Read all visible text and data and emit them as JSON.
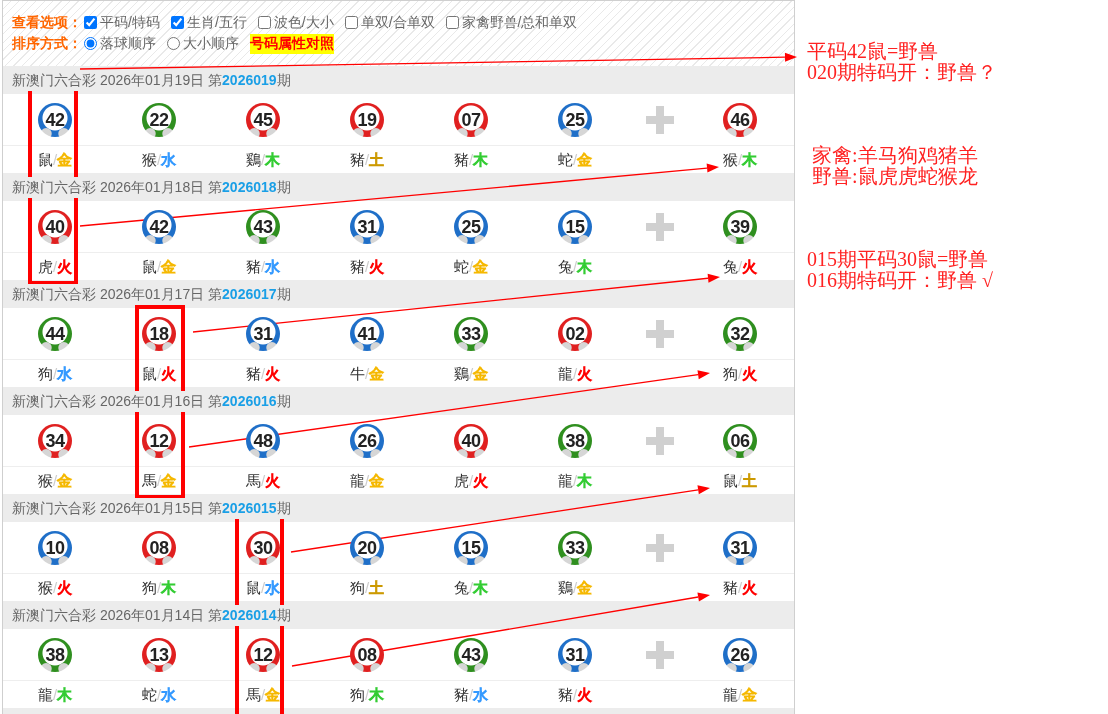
{
  "options": {
    "label": "查看选项：",
    "items": [
      {
        "label": "平码/特码",
        "checked": true
      },
      {
        "label": "生肖/五行",
        "checked": true
      },
      {
        "label": "波色/大小",
        "checked": false
      },
      {
        "label": "单双/合单双",
        "checked": false
      },
      {
        "label": "家禽野兽/总和单双",
        "checked": false
      }
    ]
  },
  "sorting": {
    "label": "排序方式：",
    "items": [
      {
        "label": "落球顺序",
        "selected": true
      },
      {
        "label": "大小顺序",
        "selected": false
      }
    ],
    "link": "号码属性对照"
  },
  "draws": [
    {
      "title": "新澳门六合彩 2026年01月19日 第**2026019**期",
      "numbers": [
        {
          "number": "42",
          "color": "#1f6fc8",
          "zodiac": "鼠",
          "separator": "/",
          "element": {
            "text": "金",
            "color": "#f5b800"
          }
        },
        {
          "number": "22",
          "color": "#2f8f1f",
          "zodiac": "猴",
          "separator": "/",
          "element": {
            "text": "水",
            "color": "#3399ff"
          }
        },
        {
          "number": "45",
          "color": "#e02020",
          "zodiac": "鷄",
          "separator": "/",
          "element": {
            "text": "木",
            "color": "#33cc33"
          }
        },
        {
          "number": "19",
          "color": "#e02020",
          "zodiac": "豬",
          "separator": "/",
          "element": {
            "text": "土",
            "color": "#cc9900"
          }
        },
        {
          "number": "07",
          "color": "#e02020",
          "zodiac": "豬",
          "separator": "/",
          "element": {
            "text": "木",
            "color": "#33cc33"
          }
        },
        {
          "number": "25",
          "color": "#1f6fc8",
          "zodiac": "蛇",
          "separator": "/",
          "element": {
            "text": "金",
            "color": "#f5b800"
          }
        }
      ],
      "special": {
        "number": "46",
        "color": "#e02020",
        "zodiac": "猴",
        "separator": "/",
        "element": {
          "text": "木",
          "color": "#33cc33"
        }
      }
    },
    {
      "title": "新澳门六合彩 2026年01月18日 第**2026018**期",
      "numbers": [
        {
          "number": "40",
          "color": "#e02020",
          "zodiac": "虎",
          "separator": "/",
          "element": {
            "text": "火",
            "color": "#ff0000"
          }
        },
        {
          "number": "42",
          "color": "#1f6fc8",
          "zodiac": "鼠",
          "separator": "/",
          "element": {
            "text": "金",
            "color": "#f5b800"
          }
        },
        {
          "number": "43",
          "color": "#2f8f1f",
          "zodiac": "豬",
          "separator": "/",
          "element": {
            "text": "水",
            "color": "#3399ff"
          }
        },
        {
          "number": "31",
          "color": "#1f6fc8",
          "zodiac": "豬",
          "separator": "/",
          "element": {
            "text": "火",
            "color": "#ff0000"
          }
        },
        {
          "number": "25",
          "color": "#1f6fc8",
          "zodiac": "蛇",
          "separator": "/",
          "element": {
            "text": "金",
            "color": "#f5b800"
          }
        },
        {
          "number": "15",
          "color": "#1f6fc8",
          "zodiac": "兔",
          "separator": "/",
          "element": {
            "text": "木",
            "color": "#33cc33"
          }
        }
      ],
      "special": {
        "number": "39",
        "color": "#2f8f1f",
        "zodiac": "兔",
        "separator": "/",
        "element": {
          "text": "火",
          "color": "#ff0000"
        }
      }
    },
    {
      "title": "新澳门六合彩 2026年01月17日 第**2026017**期",
      "numbers": [
        {
          "number": "44",
          "color": "#2f8f1f",
          "zodiac": "狗",
          "separator": "/",
          "element": {
            "text": "水",
            "color": "#3399ff"
          }
        },
        {
          "number": "18",
          "color": "#e02020",
          "zodiac": "鼠",
          "separator": "/",
          "element": {
            "text": "火",
            "color": "#ff0000"
          }
        },
        {
          "number": "31",
          "color": "#1f6fc8",
          "zodiac": "豬",
          "separator": "/",
          "element": {
            "text": "火",
            "color": "#ff0000"
          }
        },
        {
          "number": "41",
          "color": "#1f6fc8",
          "zodiac": "牛",
          "separator": "/",
          "element": {
            "text": "金",
            "color": "#f5b800"
          }
        },
        {
          "number": "33",
          "color": "#2f8f1f",
          "zodiac": "鷄",
          "separator": "/",
          "element": {
            "text": "金",
            "color": "#f5b800"
          }
        },
        {
          "number": "02",
          "color": "#e02020",
          "zodiac": "龍",
          "separator": "/",
          "element": {
            "text": "火",
            "color": "#ff0000"
          }
        }
      ],
      "special": {
        "number": "32",
        "color": "#2f8f1f",
        "zodiac": "狗",
        "separator": "/",
        "element": {
          "text": "火",
          "color": "#ff0000"
        }
      }
    },
    {
      "title": "新澳门六合彩 2026年01月16日 第**2026016**期",
      "numbers": [
        {
          "number": "34",
          "color": "#e02020",
          "zodiac": "猴",
          "separator": "/",
          "element": {
            "text": "金",
            "color": "#f5b800"
          }
        },
        {
          "number": "12",
          "color": "#e02020",
          "zodiac": "馬",
          "separator": "/",
          "element": {
            "text": "金",
            "color": "#f5b800"
          }
        },
        {
          "number": "48",
          "color": "#1f6fc8",
          "zodiac": "馬",
          "separator": "/",
          "element": {
            "text": "火",
            "color": "#ff0000"
          }
        },
        {
          "number": "26",
          "color": "#1f6fc8",
          "zodiac": "龍",
          "separator": "/",
          "element": {
            "text": "金",
            "color": "#f5b800"
          }
        },
        {
          "number": "40",
          "color": "#e02020",
          "zodiac": "虎",
          "separator": "/",
          "element": {
            "text": "火",
            "color": "#ff0000"
          }
        },
        {
          "number": "38",
          "color": "#2f8f1f",
          "zodiac": "龍",
          "separator": "/",
          "element": {
            "text": "木",
            "color": "#33cc33"
          }
        }
      ],
      "special": {
        "number": "06",
        "color": "#2f8f1f",
        "zodiac": "鼠",
        "separator": "/",
        "element": {
          "text": "土",
          "color": "#cc9900"
        }
      }
    },
    {
      "title": "新澳门六合彩 2026年01月15日 第**2026015**期",
      "numbers": [
        {
          "number": "10",
          "color": "#1f6fc8",
          "zodiac": "猴",
          "separator": "/",
          "element": {
            "text": "火",
            "color": "#ff0000"
          }
        },
        {
          "number": "08",
          "color": "#e02020",
          "zodiac": "狗",
          "separator": "/",
          "element": {
            "text": "木",
            "color": "#33cc33"
          }
        },
        {
          "number": "30",
          "color": "#e02020",
          "zodiac": "鼠",
          "separator": "/",
          "element": {
            "text": "水",
            "color": "#3399ff"
          }
        },
        {
          "number": "20",
          "color": "#1f6fc8",
          "zodiac": "狗",
          "separator": "/",
          "element": {
            "text": "土",
            "color": "#cc9900"
          }
        },
        {
          "number": "15",
          "color": "#1f6fc8",
          "zodiac": "兔",
          "separator": "/",
          "element": {
            "text": "木",
            "color": "#33cc33"
          }
        },
        {
          "number": "33",
          "color": "#2f8f1f",
          "zodiac": "鷄",
          "separator": "/",
          "element": {
            "text": "金",
            "color": "#f5b800"
          }
        }
      ],
      "special": {
        "number": "31",
        "color": "#1f6fc8",
        "zodiac": "豬",
        "separator": "/",
        "element": {
          "text": "火",
          "color": "#ff0000"
        }
      }
    },
    {
      "title": "新澳门六合彩 2026年01月14日 第**2026014**期",
      "numbers": [
        {
          "number": "38",
          "color": "#2f8f1f",
          "zodiac": "龍",
          "separator": "/",
          "element": {
            "text": "木",
            "color": "#33cc33"
          }
        },
        {
          "number": "13",
          "color": "#e02020",
          "zodiac": "蛇",
          "separator": "/",
          "element": {
            "text": "水",
            "color": "#3399ff"
          }
        },
        {
          "number": "12",
          "color": "#e02020",
          "zodiac": "馬",
          "separator": "/",
          "element": {
            "text": "金",
            "color": "#f5b800"
          }
        },
        {
          "number": "08",
          "color": "#e02020",
          "zodiac": "狗",
          "separator": "/",
          "element": {
            "text": "木",
            "color": "#33cc33"
          }
        },
        {
          "number": "43",
          "color": "#2f8f1f",
          "zodiac": "豬",
          "separator": "/",
          "element": {
            "text": "水",
            "color": "#3399ff"
          }
        },
        {
          "number": "31",
          "color": "#1f6fc8",
          "zodiac": "豬",
          "separator": "/",
          "element": {
            "text": "火",
            "color": "#ff0000"
          }
        }
      ],
      "special": {
        "number": "26",
        "color": "#1f6fc8",
        "zodiac": "龍",
        "separator": "/",
        "element": {
          "text": "金",
          "color": "#f5b800"
        }
      }
    }
  ],
  "notes": [
    {
      "lines": [
        "平码42鼠=野兽",
        "020期特码开：野兽？"
      ]
    },
    {
      "lines": [
        "家禽:羊马狗鸡猪羊",
        "野兽:鼠虎虎蛇猴龙"
      ]
    },
    {
      "lines": [
        "015期平码30鼠=野兽",
        "016期特码开：野兽 √"
      ]
    }
  ]
}
